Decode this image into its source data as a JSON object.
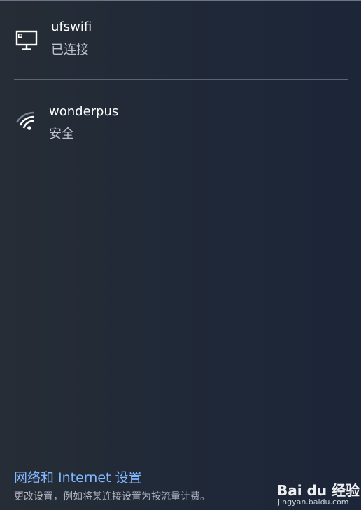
{
  "networks": {
    "wired": {
      "name": "ufswifi",
      "status": "已连接",
      "icon": "ethernet-monitor-icon"
    },
    "wifi": {
      "name": "wonderpus",
      "status": "安全",
      "icon": "wifi-signal-icon"
    }
  },
  "settings": {
    "link_label": "网络和 Internet 设置",
    "description": "更改设置，例如将某连接设置为按流量计费。"
  },
  "watermark": {
    "logo": "Bai du 经验",
    "site": "jingyan.baidu.com"
  },
  "colors": {
    "link": "#80b7ff",
    "background": "#1f2838",
    "divider": "#5a6474"
  }
}
